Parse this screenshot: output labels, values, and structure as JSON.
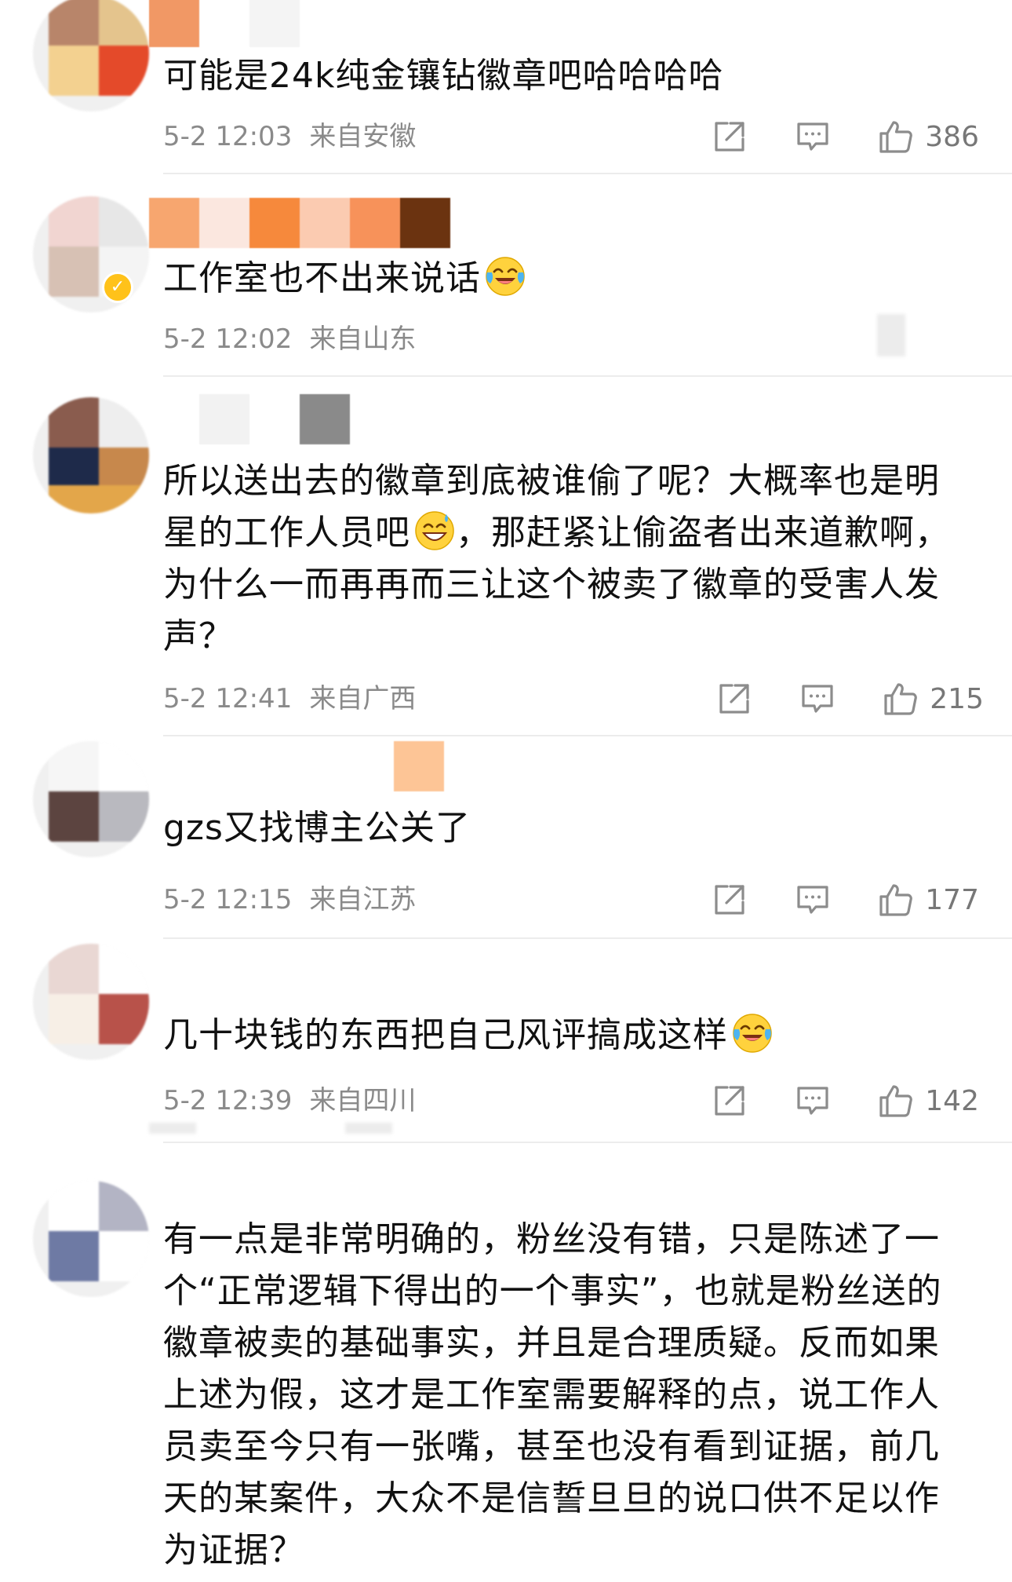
{
  "colors": {
    "text": "#111111",
    "meta": "#8a8a8a",
    "divider": "#ececec",
    "icon": "#8c8c8c",
    "verified_badge": "#ffc21a"
  },
  "comments": [
    {
      "text": "可能是24k纯金镶钻徽章吧哈哈哈哈",
      "time": "5-2 12:03",
      "location": "来自安徽",
      "likes": "386"
    },
    {
      "text": "工作室也不出来说话",
      "emoji": "crying-laughing-face-icon",
      "time": "5-2 12:02",
      "location": "来自山东"
    },
    {
      "text_before_emoji": "所以送出去的徽章到底被谁偷了呢？大概率也是明星的工作人员吧",
      "emoji": "grinning-sweat-face-icon",
      "text_after_emoji": "，那赶紧让偷盗者出来道歉啊，为什么一而再再而三让这个被卖了徽章的受害人发声？",
      "time": "5-2 12:41",
      "location": "来自广西",
      "likes": "215"
    },
    {
      "text": "gzs又找博主公关了",
      "time": "5-2 12:15",
      "location": "来自江苏",
      "likes": "177"
    },
    {
      "text": "几十块钱的东西把自己风评搞成这样",
      "emoji": "crying-laughing-face-icon",
      "time": "5-2 12:39",
      "location": "来自四川",
      "likes": "142"
    },
    {
      "text": "有一点是非常明确的，粉丝没有错，只是陈述了一个“正常逻辑下得出的一个事实”，也就是粉丝送的徽章被卖的基础事实，并且是合理质疑。反而如果上述为假，这才是工作室需要解释的点，说工作人员卖至今只有一张嘴，甚至也没有看到证据，前几天的某案件，大众不是信誓旦旦的说口供不足以作为证据？"
    }
  ]
}
